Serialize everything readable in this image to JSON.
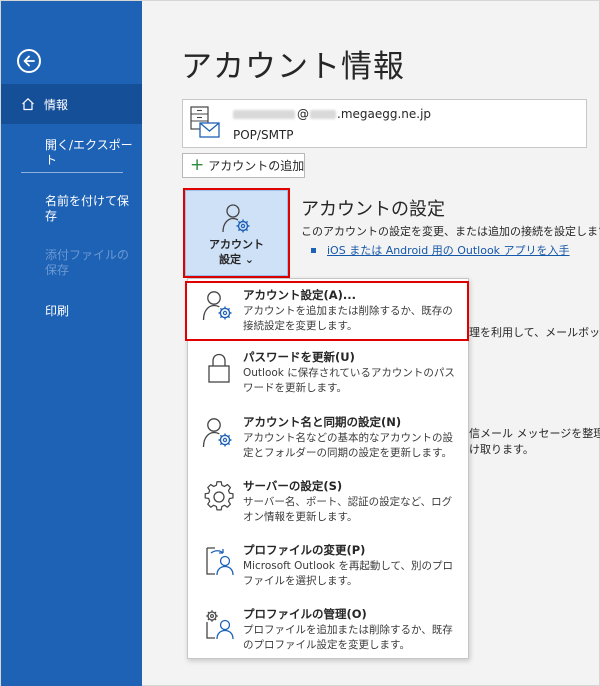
{
  "sidebar": {
    "back_icon": "back-arrow-icon",
    "items": [
      {
        "label": "情報",
        "icon": "home-icon",
        "active": true
      },
      {
        "label": "開く/エクスポート"
      },
      {
        "label": "名前を付けて保存"
      },
      {
        "label": "添付ファイルの保存",
        "disabled": true
      },
      {
        "label": "印刷"
      }
    ]
  },
  "page_title": "アカウント情報",
  "account": {
    "email_suffix": "@",
    "email_domain": ".megaegg.ne.jp",
    "type": "POP/SMTP"
  },
  "add_account_label": "アカウントの追加",
  "account_settings_button": {
    "line1": "アカウント",
    "line2": "設定 ⌄"
  },
  "account_settings_section": {
    "title": "アカウントの設定",
    "description": "このアカウントの設定を変更、または追加の接続を設定します。",
    "link": "iOS または Android 用の Outlook アプリを入手"
  },
  "background_text": {
    "mailbox_fragment": "理を利用して、メールボックス",
    "rules_fragment_1": "信メール メッセージを整理し",
    "rules_fragment_2": "け取ります。"
  },
  "menu": [
    {
      "title": "アカウント設定(A)...",
      "description": "アカウントを追加または削除するか、既存の接続設定を変更します。",
      "icon": "account-settings-icon",
      "highlighted": true
    },
    {
      "title": "パスワードを更新(U)",
      "description": "Outlook に保存されているアカウントのパスワードを更新します。",
      "icon": "lock-icon"
    },
    {
      "title": "アカウント名と同期の設定(N)",
      "description": "アカウント名などの基本的なアカウントの設定とフォルダーの同期の設定を更新します。",
      "icon": "account-sync-icon"
    },
    {
      "title": "サーバーの設定(S)",
      "description": "サーバー名、ポート、認証の設定など、ログオン情報を更新します。",
      "icon": "gear-icon"
    },
    {
      "title": "プロファイルの変更(P)",
      "description": "Microsoft Outlook を再起動して、別のプロファイルを選択します。",
      "icon": "change-profile-icon"
    },
    {
      "title": "プロファイルの管理(O)",
      "description": "プロファイルを追加または削除するか、既存のプロファイル設定を変更します。",
      "icon": "manage-profile-icon"
    }
  ],
  "colors": {
    "sidebar": "#1e62b6",
    "sidebar_active": "#154f98",
    "highlight_border": "#e00000",
    "link": "#1557a8"
  }
}
